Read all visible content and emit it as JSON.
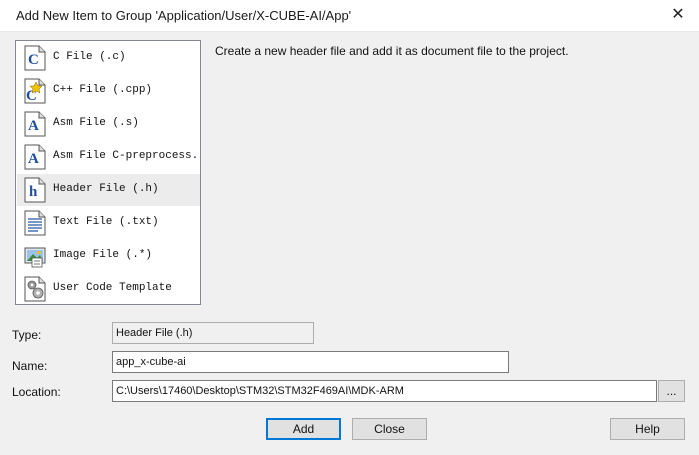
{
  "window": {
    "title": "Add New Item to Group 'Application/User/X-CUBE-AI/App'",
    "close_glyph": "✕"
  },
  "file_types": [
    {
      "label": "C File (.c)",
      "icon": "c-file-icon",
      "glyph": "C"
    },
    {
      "label": "C++ File (.cpp)",
      "icon": "cpp-file-icon",
      "glyph": "C"
    },
    {
      "label": "Asm File (.s)",
      "icon": "asm-file-icon",
      "glyph": "A"
    },
    {
      "label": "Asm File C-preprocess...",
      "icon": "asm-preprocessor-file-icon",
      "glyph": "A"
    },
    {
      "label": "Header File (.h)",
      "icon": "header-file-icon",
      "glyph": "h",
      "selected": true
    },
    {
      "label": "Text File (.txt)",
      "icon": "text-file-icon"
    },
    {
      "label": "Image File (.*)",
      "icon": "image-file-icon"
    },
    {
      "label": "User Code Template",
      "icon": "user-code-template-icon"
    }
  ],
  "description": "Create a new header file and add it as document file to the project.",
  "form": {
    "type_label": "Type:",
    "type_value": "Header File (.h)",
    "name_label": "Name:",
    "name_value": "app_x-cube-ai",
    "location_label": "Location:",
    "location_value": "C:\\Users\\17460\\Desktop\\STM32\\STM32F469AI\\MDK-ARM",
    "browse_label": "..."
  },
  "buttons": {
    "add": "Add",
    "close": "Close",
    "help": "Help"
  },
  "colors": {
    "accent": "#0078d7",
    "icon_blue": "#1f4e9c",
    "selected_row": "#ececec"
  }
}
